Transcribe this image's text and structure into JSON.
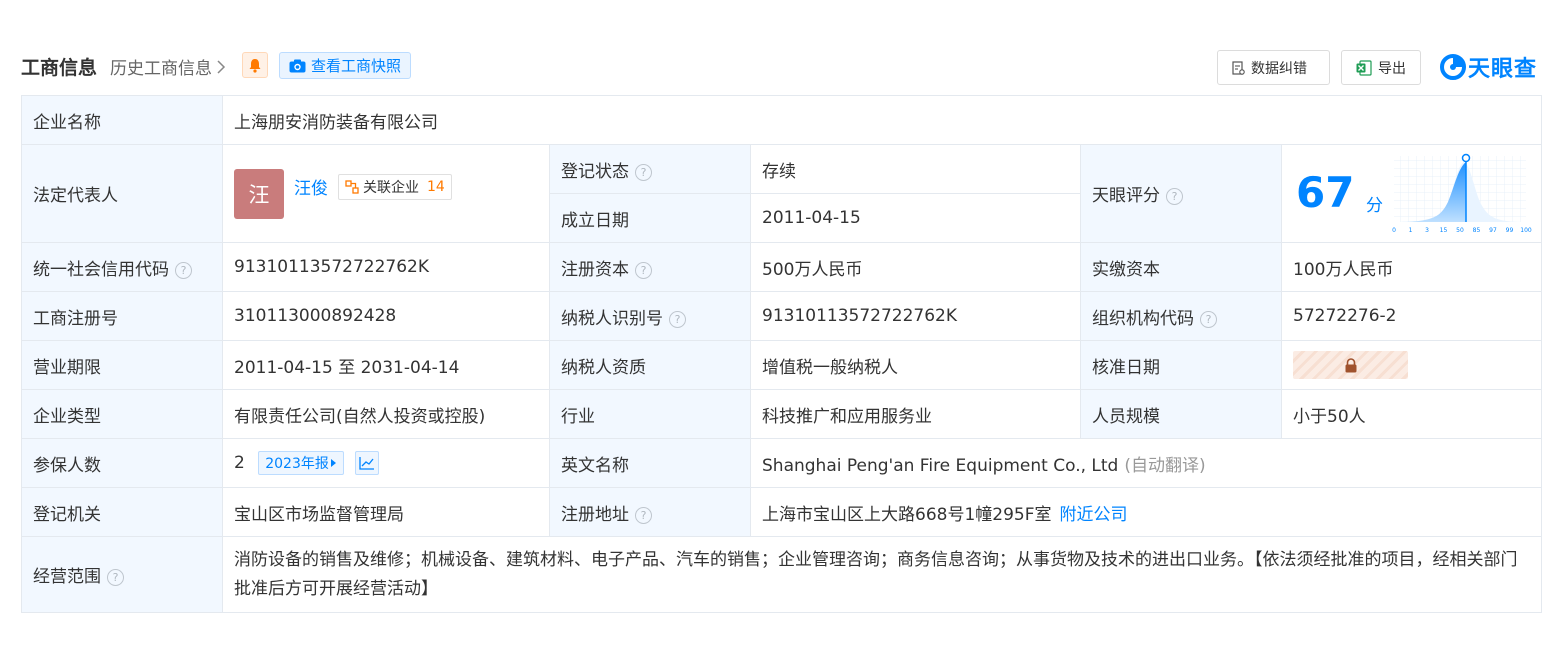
{
  "header": {
    "title": "工商信息",
    "history_link": "历史工商信息",
    "snapshot_button": "查看工商快照",
    "correct_button": "数据纠错",
    "export_button": "导出",
    "logo_text": "天眼查"
  },
  "table": {
    "company_name_label": "企业名称",
    "company_name": "上海朋安消防装备有限公司",
    "legal_rep_label": "法定代表人",
    "legal_rep_avatar": "汪",
    "legal_rep_name": "汪俊",
    "related_label": "关联企业",
    "related_count": "14",
    "reg_status_label": "登记状态",
    "reg_status": "存续",
    "found_date_label": "成立日期",
    "found_date": "2011-04-15",
    "score_label": "天眼评分",
    "score_value": "67",
    "score_unit": "分",
    "credit_code_label": "统一社会信用代码",
    "credit_code": "91310113572722762K",
    "reg_capital_label": "注册资本",
    "reg_capital": "500万人民币",
    "paid_capital_label": "实缴资本",
    "paid_capital": "100万人民币",
    "reg_number_label": "工商注册号",
    "reg_number": "310113000892428",
    "taxpayer_id_label": "纳税人识别号",
    "taxpayer_id": "91310113572722762K",
    "org_code_label": "组织机构代码",
    "org_code": "57272276-2",
    "business_term_label": "营业期限",
    "business_term": "2011-04-15 至 2031-04-14",
    "taxpayer_qual_label": "纳税人资质",
    "taxpayer_qual": "增值税一般纳税人",
    "approval_date_label": "核准日期",
    "company_type_label": "企业类型",
    "company_type": "有限责任公司(自然人投资或控股)",
    "industry_label": "行业",
    "industry": "科技推广和应用服务业",
    "staff_size_label": "人员规模",
    "staff_size": "小于50人",
    "insured_label": "参保人数",
    "insured_count": "2",
    "insured_report": "2023年报",
    "english_name_label": "英文名称",
    "english_name": "Shanghai Peng'an Fire Equipment Co., Ltd",
    "english_name_note": "(自动翻译)",
    "reg_authority_label": "登记机关",
    "reg_authority": "宝山区市场监督管理局",
    "reg_address_label": "注册地址",
    "reg_address": "上海市宝山区上大路668号1幢295F室",
    "nearby_link": "附近公司",
    "business_scope_label": "经营范围",
    "business_scope": "消防设备的销售及维修；机械设备、建筑材料、电子产品、汽车的销售；企业管理咨询；商务信息咨询；从事货物及技术的进出口业务。【依法须经批准的项目，经相关部门批准后方可开展经营活动】"
  },
  "score_chart": {
    "ticks": [
      "0",
      "1",
      "3",
      "15",
      "50",
      "85",
      "97",
      "99",
      "100"
    ],
    "marker_value": 67
  },
  "colors": {
    "accent": "#0084ff",
    "label_bg": "#f2f8ff",
    "status_green": "#1ea04c",
    "border": "#e4e9ef"
  }
}
